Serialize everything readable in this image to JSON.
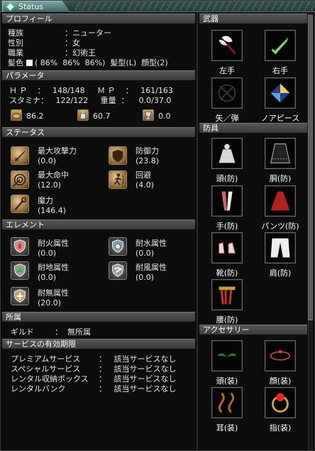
{
  "window": {
    "title": "Status"
  },
  "profile": {
    "header": "プロフィール",
    "rows": [
      {
        "label": "種族",
        "value": "：ニューター"
      },
      {
        "label": "性別",
        "value": "：女"
      },
      {
        "label": "職業",
        "value": "：幻術王"
      },
      {
        "label": "髪色",
        "value": "( 86%  86%  86%)  髪型(L)  顔型(2)"
      }
    ]
  },
  "params": {
    "header": "パラメータ",
    "line1": "Ｈ Ｐ    ：   148/148     Ｍ Ｐ    ：   161/163",
    "line2": "スタミナ：   122/122     重量  ：    0.0/37.0",
    "minis": [
      "86.2",
      "60.7",
      "0.0"
    ]
  },
  "status": {
    "header": "ステータス",
    "items": [
      {
        "label": "最大攻撃力",
        "value": "(0.0)",
        "icon": "sword-icon"
      },
      {
        "label": "防御力",
        "value": "(23.8)",
        "icon": "shield-icon"
      },
      {
        "label": "最大命中",
        "value": "(12.0)",
        "icon": "target-icon"
      },
      {
        "label": "回避",
        "value": "(4.0)",
        "icon": "dodge-icon"
      },
      {
        "label": "魔力",
        "value": "(146.4)",
        "icon": "staff-icon"
      }
    ]
  },
  "element": {
    "header": "エレメント",
    "items": [
      {
        "label": "耐火属性",
        "value": "(0.0)",
        "icon": "fire-shield-icon"
      },
      {
        "label": "耐水属性",
        "value": "(0.0)",
        "icon": "water-shield-icon"
      },
      {
        "label": "耐地属性",
        "value": "(0.0)",
        "icon": "earth-shield-icon"
      },
      {
        "label": "耐風属性",
        "value": "(0.0)",
        "icon": "wind-shield-icon"
      },
      {
        "label": "耐無属性",
        "value": "(20.0)",
        "icon": "none-shield-icon"
      }
    ]
  },
  "affiliation": {
    "header": "所属",
    "guild_label": "ギルド",
    "guild_value": "：  無所属"
  },
  "services": {
    "header": "サービスの有効期限",
    "rows": [
      {
        "name": "プレミアムサービス",
        "value": "：   該当サービスなし"
      },
      {
        "name": "スペシャルサービス",
        "value": "：   該当サービスなし"
      },
      {
        "name": "レンタル収納ボックス",
        "value": "：   該当サービスなし"
      },
      {
        "name": "レンタルバンク",
        "value": "：   該当サービスなし"
      }
    ]
  },
  "weapons": {
    "header": "武器",
    "slots": [
      "左手",
      "右手",
      "矢／弾",
      "ノアピース"
    ]
  },
  "armor": {
    "header": "防具",
    "slots": [
      "頭(防)",
      "胴(防)",
      "手(防)",
      "パンツ(防)",
      "靴(防)",
      "肩(防)",
      "腰(防)"
    ]
  },
  "accessory": {
    "header": "アクセサリー",
    "slots": [
      "頭(装)",
      "顔(装)",
      "耳(装)",
      "指(装)"
    ]
  },
  "colors": {
    "hair_swatch": "#ffffff",
    "header_bg": "#4a4a4a",
    "title_bar": "#3c5a58"
  }
}
